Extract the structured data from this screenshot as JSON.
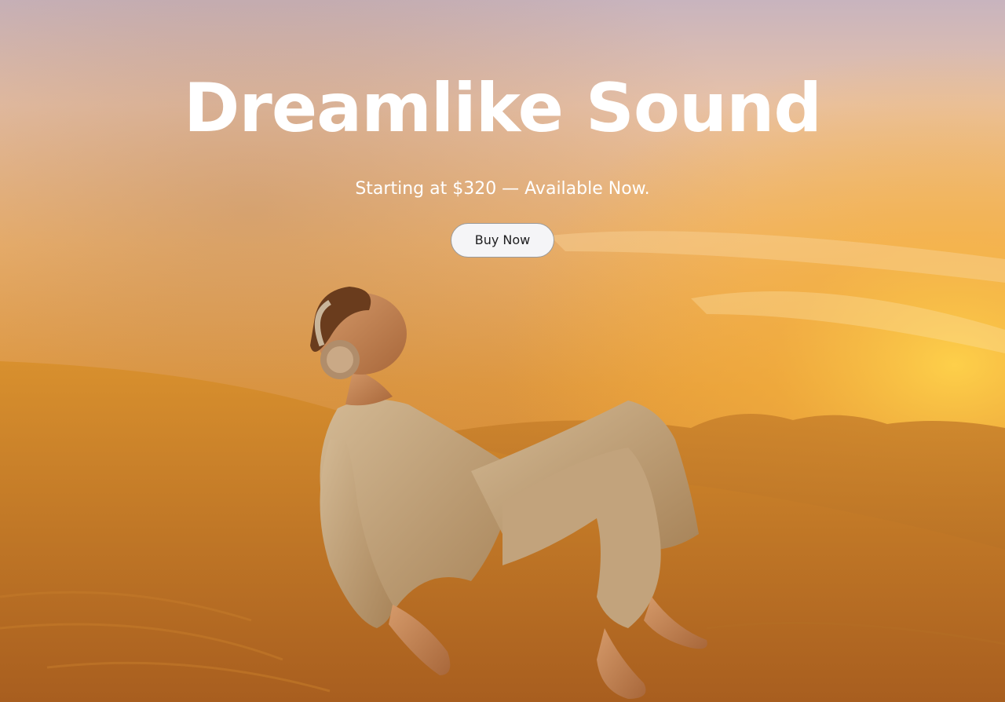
{
  "hero": {
    "title": "Dreamlike Sound",
    "subtitle": "Starting at $320 — Available Now.",
    "cta_label": "Buy Now",
    "image_description": "desert-dunes-floating-man-with-headphones"
  },
  "colors": {
    "title_text": "#ffffff",
    "button_bg": "#f5f5f7",
    "button_text": "#1d1d1f",
    "sky_top": "#c9b6bd",
    "sand": "#dd9034"
  }
}
